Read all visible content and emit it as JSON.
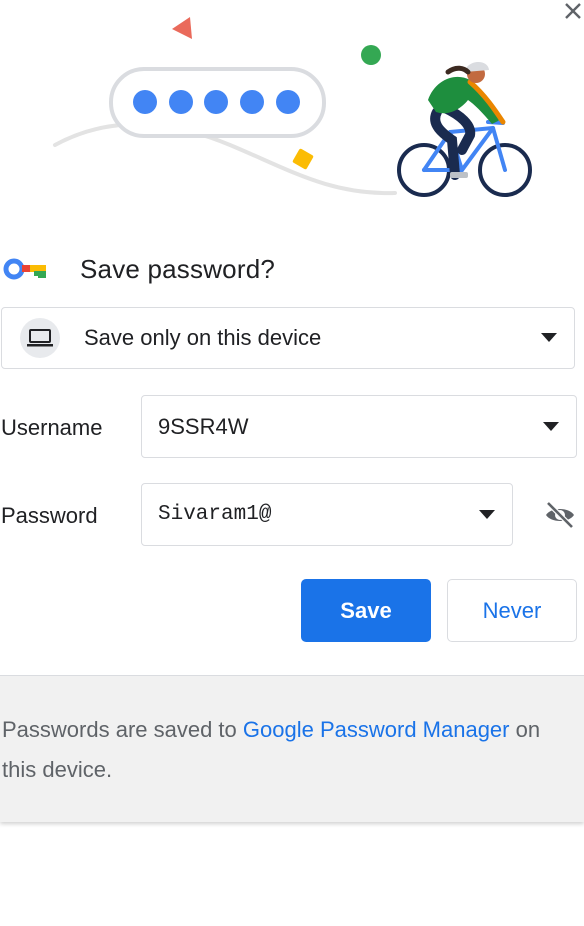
{
  "dialog": {
    "title": "Save password?",
    "close_icon": "close-icon",
    "illustration_icon": "cyclist-password-illustration",
    "key_icon": "key-icon"
  },
  "storage": {
    "label": "Save only on this device",
    "icon": "laptop-icon"
  },
  "username": {
    "label": "Username",
    "value": "9SSR4W"
  },
  "password": {
    "label": "Password",
    "value": "Sivaram1@",
    "toggle_icon": "eye-off-icon"
  },
  "buttons": {
    "save_label": "Save",
    "never_label": "Never"
  },
  "footer": {
    "text_before": "Passwords are saved to ",
    "link_text": "Google Password Manager",
    "text_after": " on this device."
  },
  "colors": {
    "primary_blue": "#1a73e8",
    "border_gray": "#dadce0",
    "footer_bg": "#f1f1f1",
    "text_dark": "#202124",
    "text_muted": "#5f6368"
  }
}
